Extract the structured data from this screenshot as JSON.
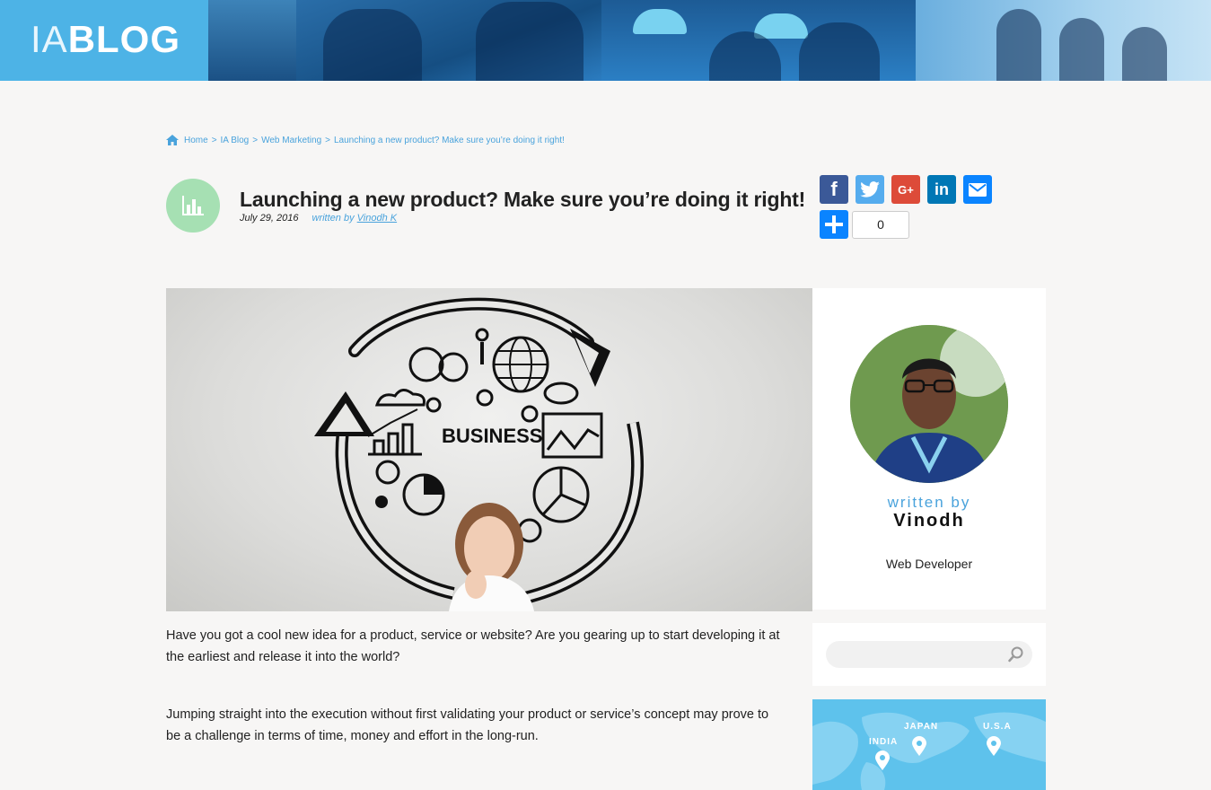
{
  "header": {
    "logo_thin": "IA",
    "logo_bold": "BLOG"
  },
  "breadcrumb": {
    "items": [
      "Home",
      "IA Blog",
      "Web Marketing",
      "Launching a new product? Make sure you’re doing it right!"
    ],
    "separator": ">"
  },
  "post": {
    "category_icon": "bar-chart-icon",
    "title": "Launching a new product? Make sure you’re doing it right!",
    "date": "July 29, 2016",
    "written_by": "written by",
    "author_link": "Vinodh K"
  },
  "share": {
    "facebook": "f",
    "twitter": "twitter-bird-icon",
    "googleplus": "G+",
    "linkedin": "in",
    "email": "email-icon",
    "count": "0"
  },
  "hero": {
    "center_word": "BUSINESS"
  },
  "article": {
    "paragraphs": [
      "Have you got a cool new idea for a product, service or website? Are you gearing up to start developing it at the earliest and release it into the world?",
      "Jumping straight into the execution without first validating your product or service’s concept may prove to be a challenge in terms of time, money and effort in the long-run."
    ]
  },
  "sidebar": {
    "author_card": {
      "written_by": "written by",
      "name": "Vinodh",
      "role": "Web Developer"
    },
    "search": {
      "placeholder": ""
    },
    "map": {
      "labels": [
        "INDIA",
        "JAPAN",
        "U.S.A"
      ]
    }
  },
  "colors": {
    "accent": "#4aa3dc",
    "facebook": "#3b5998",
    "twitter": "#55acee",
    "googleplus": "#dd4b39",
    "linkedin": "#0077b5",
    "email": "#0a84ff",
    "category_badge": "#a6e0b3",
    "map_bg": "#5ec2ec"
  }
}
